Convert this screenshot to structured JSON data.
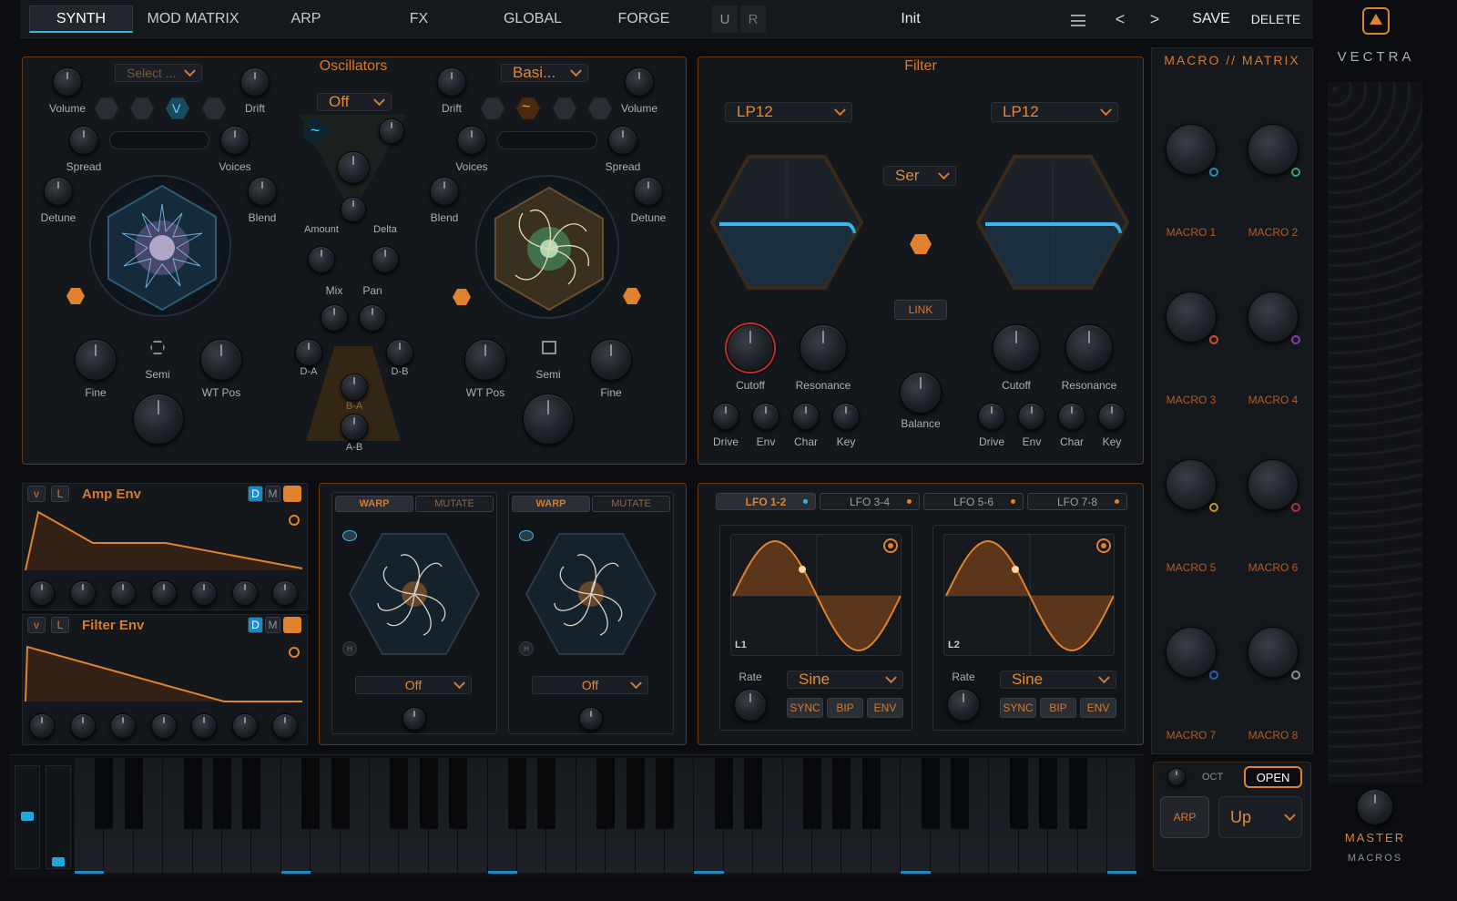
{
  "tabs": [
    "SYNTH",
    "MOD MATRIX",
    "ARP",
    "FX",
    "GLOBAL",
    "FORGE"
  ],
  "header": {
    "u": "U",
    "r": "R",
    "preset": "Init",
    "prev": "<",
    "next": ">",
    "save": "SAVE",
    "delete": "DELETE"
  },
  "brand": "VECTRA",
  "osc": {
    "title": "Oscillators",
    "left_select": "Select ...",
    "right_select": "Basi...",
    "mode": "Off",
    "left": {
      "volume": "Volume",
      "drift": "Drift",
      "spread": "Spread",
      "voices": "Voices",
      "detune": "Detune",
      "blend": "Blend",
      "fine": "Fine",
      "semi": "Semi",
      "wtpos": "WT Pos"
    },
    "right": {
      "drift": "Drift",
      "volume": "Volume",
      "voices": "Voices",
      "spread": "Spread",
      "blend": "Blend",
      "detune": "Detune",
      "wtpos": "WT Pos",
      "semi": "Semi",
      "fine": "Fine"
    },
    "center": {
      "amount": "Amount",
      "delta": "Delta",
      "mix": "Mix",
      "pan": "Pan",
      "da": "D-A",
      "db": "D-B",
      "ba": "B-A",
      "ab": "A-B"
    }
  },
  "filter": {
    "title": "Filter",
    "type1": "LP12",
    "type2": "LP12",
    "routing": "Ser",
    "link": "LINK",
    "cutoff": "Cutoff",
    "resonance": "Resonance",
    "balance": "Balance",
    "drive": "Drive",
    "env": "Env",
    "char": "Char",
    "key": "Key"
  },
  "macro": {
    "title": "MACRO // MATRIX",
    "labels": [
      "MACRO 1",
      "MACRO 2",
      "MACRO 3",
      "MACRO 4",
      "MACRO 5",
      "MACRO 6",
      "MACRO 7",
      "MACRO 8"
    ],
    "dot_colors": [
      "#2d8fa8",
      "#3aa36a",
      "#d4502a",
      "#8a3aa8",
      "#c9902a",
      "#b03040",
      "#2d5fa8",
      "#8a8f96"
    ]
  },
  "amp_env": {
    "v": "v",
    "l": "L",
    "title": "Amp Env",
    "d": "D",
    "m": "M"
  },
  "filter_env": {
    "v": "v",
    "l": "L",
    "title": "Filter Env",
    "d": "D",
    "m": "M"
  },
  "warp": {
    "warp": "WARP",
    "mutate": "MUTATE",
    "off": "Off",
    "h": "H"
  },
  "lfo": {
    "tabs": [
      "LFO 1-2",
      "LFO 3-4",
      "LFO 5-6",
      "LFO 7-8"
    ],
    "l1": "L1",
    "l2": "L2",
    "rate": "Rate",
    "shape": "Sine",
    "sync": "SYNC",
    "bip": "BIP",
    "env": "ENV"
  },
  "arp": {
    "oct": "OCT",
    "open": "OPEN",
    "arp": "ARP",
    "dir": "Up"
  },
  "master": {
    "master": "MASTER",
    "macros": "MACROS"
  },
  "colors": {
    "accent": "#e0822e",
    "blue": "#3bb6e8",
    "panel": "#14171c",
    "border": "#6b3a14"
  }
}
